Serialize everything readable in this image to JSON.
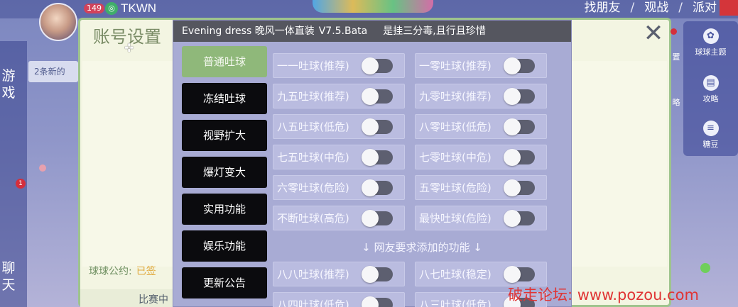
{
  "topbar": {
    "level": "149",
    "player_name": "TKWN",
    "links": [
      "找朋友",
      "观战",
      "派对"
    ],
    "separator": "/"
  },
  "left_sidebar": {
    "game_label": "游\n戏",
    "chat_label": "聊\n天",
    "message_notice": "2条新的",
    "notification_count": "1"
  },
  "right_sidebar": {
    "items": [
      {
        "label": "球球主题",
        "icon": "palette-icon"
      },
      {
        "label": "攻略",
        "icon": "book-icon"
      },
      {
        "label": "糖豆",
        "icon": "candy-icon"
      }
    ],
    "edge_labels": [
      "置",
      "略"
    ]
  },
  "account_dialog": {
    "title": "账号设置",
    "close_glyph": "✕",
    "announcement_label": "球球公约:",
    "announcement_value": "已签",
    "match_label": "比赛中"
  },
  "cheat_menu": {
    "title": "Evening dress 晚风一体直装",
    "version": "V7.5.Bata",
    "slogan": "是挂三分毒,且行且珍惜",
    "categories": [
      {
        "label": "普通吐球",
        "active": true
      },
      {
        "label": "冻结吐球",
        "active": false
      },
      {
        "label": "视野扩大",
        "active": false
      },
      {
        "label": "爆灯变大",
        "active": false
      },
      {
        "label": "实用功能",
        "active": false
      },
      {
        "label": "娱乐功能",
        "active": false
      },
      {
        "label": "更新公告",
        "active": false
      }
    ],
    "options": [
      {
        "label": "一一吐球(推荐)",
        "enabled": false
      },
      {
        "label": "一零吐球(推荐)",
        "enabled": false
      },
      {
        "label": "九五吐球(推荐)",
        "enabled": false
      },
      {
        "label": "九零吐球(推荐)",
        "enabled": false
      },
      {
        "label": "八五吐球(低危)",
        "enabled": false
      },
      {
        "label": "八零吐球(低危)",
        "enabled": false
      },
      {
        "label": "七五吐球(中危)",
        "enabled": false
      },
      {
        "label": "七零吐球(中危)",
        "enabled": false
      },
      {
        "label": "六零吐球(危险)",
        "enabled": false
      },
      {
        "label": "五零吐球(危险)",
        "enabled": false
      },
      {
        "label": "不断吐球(高危)",
        "enabled": false
      },
      {
        "label": "最快吐球(危险)",
        "enabled": false
      }
    ],
    "section_note": "↓ 网友要求添加的功能 ↓",
    "extra_options": [
      {
        "label": "八八吐球(推荐)",
        "enabled": false
      },
      {
        "label": "八七吐球(稳定)",
        "enabled": false
      },
      {
        "label": "八四吐球(低危)",
        "enabled": false
      },
      {
        "label": "八三吐球(低危)",
        "enabled": false
      }
    ]
  },
  "watermark": "破走论坛: www.pozou.com",
  "colors": {
    "active_category": "#8fb87a",
    "inactive_category": "#0b0b0e",
    "menu_background": "#a8abd4",
    "titlebar": "#55565f",
    "watermark": "#e03434"
  }
}
